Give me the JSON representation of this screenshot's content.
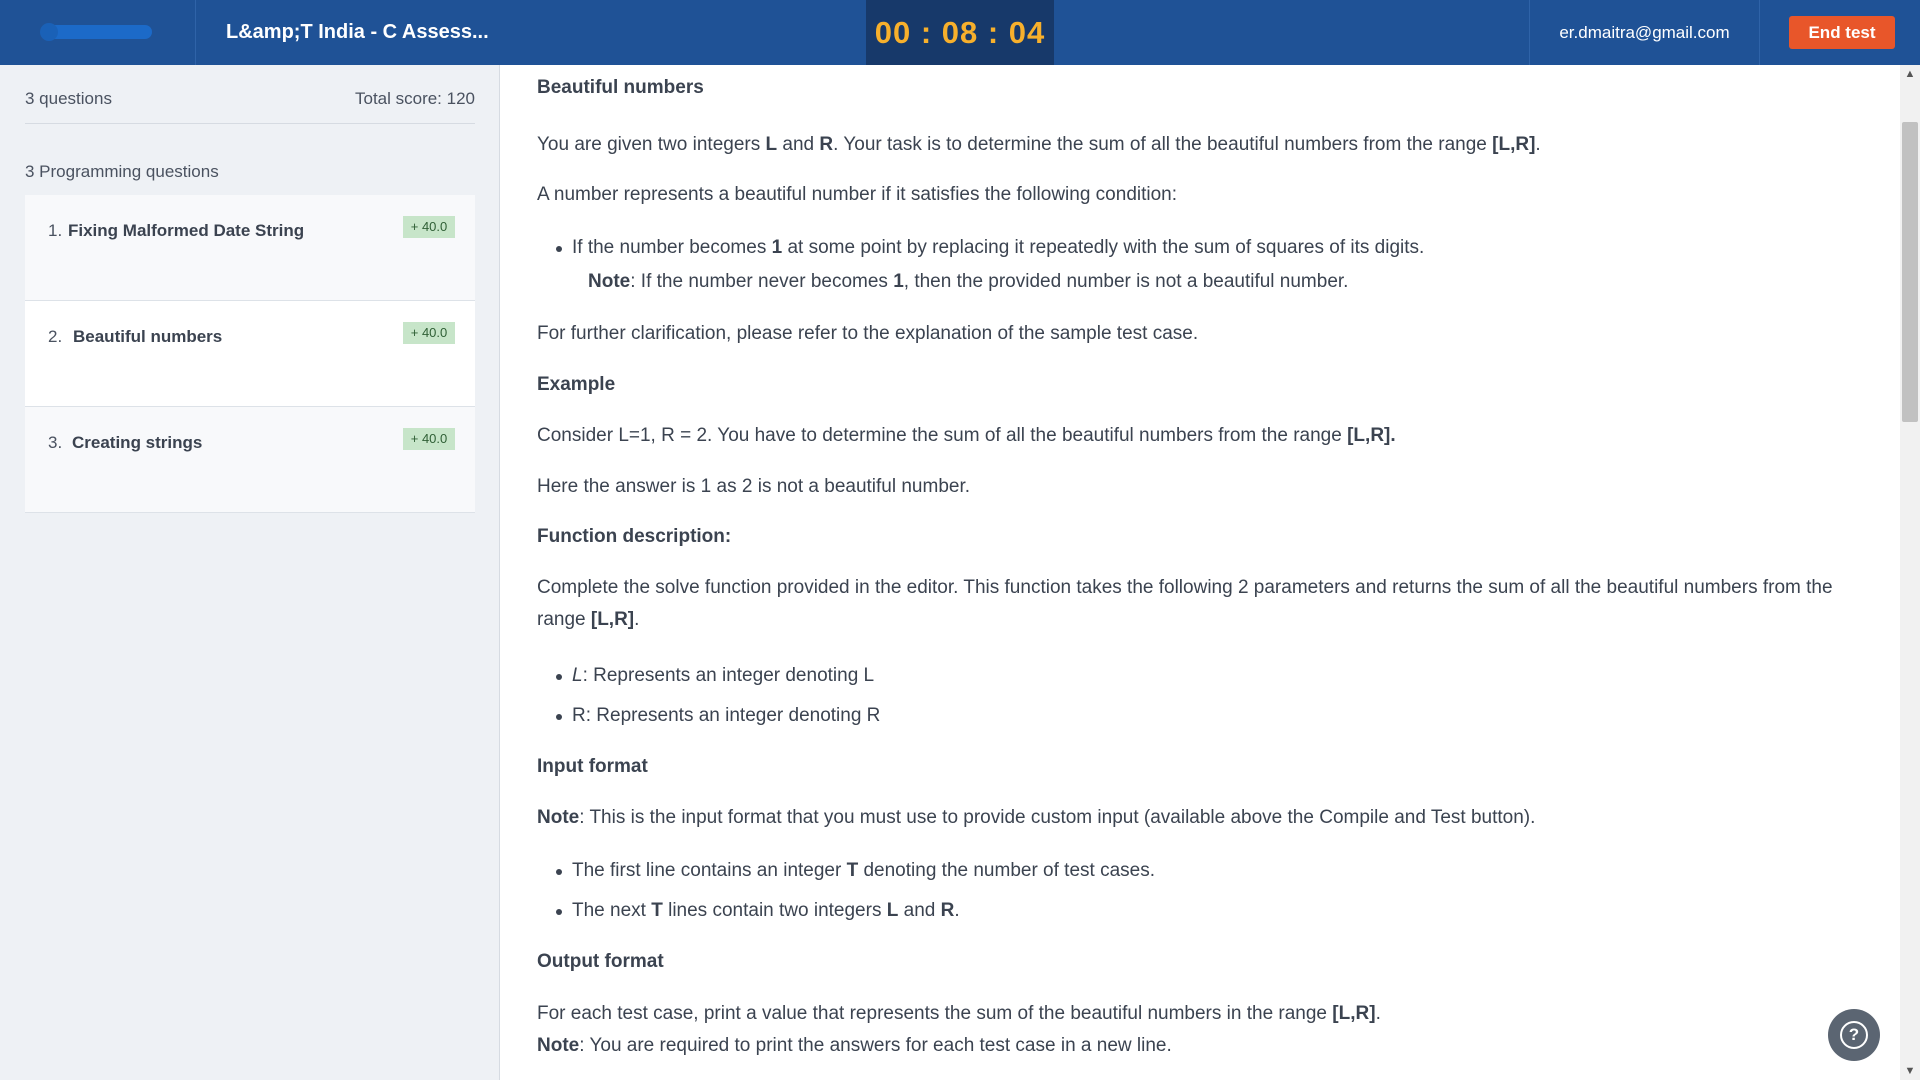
{
  "header": {
    "test_title": "L&amp;T India - C Assess...",
    "timer": "00 : 08 : 04",
    "user_email": "er.dmaitra@gmail.com",
    "end_test_label": "End test",
    "logo_icon": "hackerearth-logo-icon"
  },
  "sidebar": {
    "question_count": "3 questions",
    "total_score": "Total score: 120",
    "section_title": "3 Programming questions",
    "questions": [
      {
        "num": "1.",
        "title": "Fixing Malformed Date String",
        "score": "+ 40.0"
      },
      {
        "num": "2.",
        "title": "Beautiful numbers",
        "score": "+ 40.0"
      },
      {
        "num": "3.",
        "title": "Creating strings",
        "score": "+ 40.0"
      }
    ]
  },
  "problem": {
    "title": "Beautiful numbers",
    "intro_a": "You are given two integers ",
    "intro_b": "L",
    "intro_c": " and ",
    "intro_d": "R",
    "intro_e": ". Your task is to determine the sum of all the beautiful numbers from the range ",
    "intro_f": "[L,R]",
    "intro_g": ".",
    "condition_intro": "A number represents a beautiful number if it satisfies the following condition:",
    "cond_bullet_a": "If the number becomes ",
    "cond_bullet_b": "1",
    "cond_bullet_c": " at some point by replacing it repeatedly with the sum of squares of its digits.",
    "cond_note_label": "Note",
    "cond_note_a": ": If the number never becomes ",
    "cond_note_b": "1",
    "cond_note_c": ", then the provided number is not a beautiful number.",
    "clarification": "For further clarification, please refer to the explanation of the sample test case.",
    "example_heading": "Example",
    "example_a": "Consider L=1, R = 2. You have to determine the sum of all the beautiful numbers from the range ",
    "example_b": "[L,R].",
    "example_answer": "Here the answer is 1 as 2 is not a beautiful number.",
    "function_heading": "Function description:",
    "function_a": "Complete the solve function provided in the editor. This function takes the following 2 parameters and returns the sum of all the beautiful numbers from the range ",
    "function_b": "[L,R]",
    "function_c": ".",
    "param_l_name": "L",
    "param_l_text": ": Represents an integer denoting L",
    "param_r_text": "R: Represents an integer denoting R",
    "input_heading": "Input format",
    "input_note_label": "Note",
    "input_note_text": ": This is the input format that you must use to provide custom input (available above the Compile and Test button).",
    "input_b1_a": "The first line contains an integer ",
    "input_b1_b": "T",
    "input_b1_c": " denoting the number of test cases.",
    "input_b2_a": "The next ",
    "input_b2_b": "T",
    "input_b2_c": " lines contain two integers ",
    "input_b2_d": "L",
    "input_b2_e": " and ",
    "input_b2_f": "R",
    "input_b2_g": ".",
    "output_heading": "Output format",
    "output_a": "For each test case, print a value that represents the sum of the beautiful numbers in the range ",
    "output_b": "[L,R]",
    "output_c": ".",
    "output_note_label": "Note",
    "output_note_text": ": You are required to print the answers for each test case in a new line."
  },
  "help_icon": "question-circle-icon",
  "colors": {
    "header_bg": "#1f5296",
    "timer_bg": "#17396a",
    "timer_text": "#f7b02c",
    "end_button": "#e8562a",
    "score_badge": "#c7e5c9",
    "sidebar_bg": "#eef1f5"
  }
}
